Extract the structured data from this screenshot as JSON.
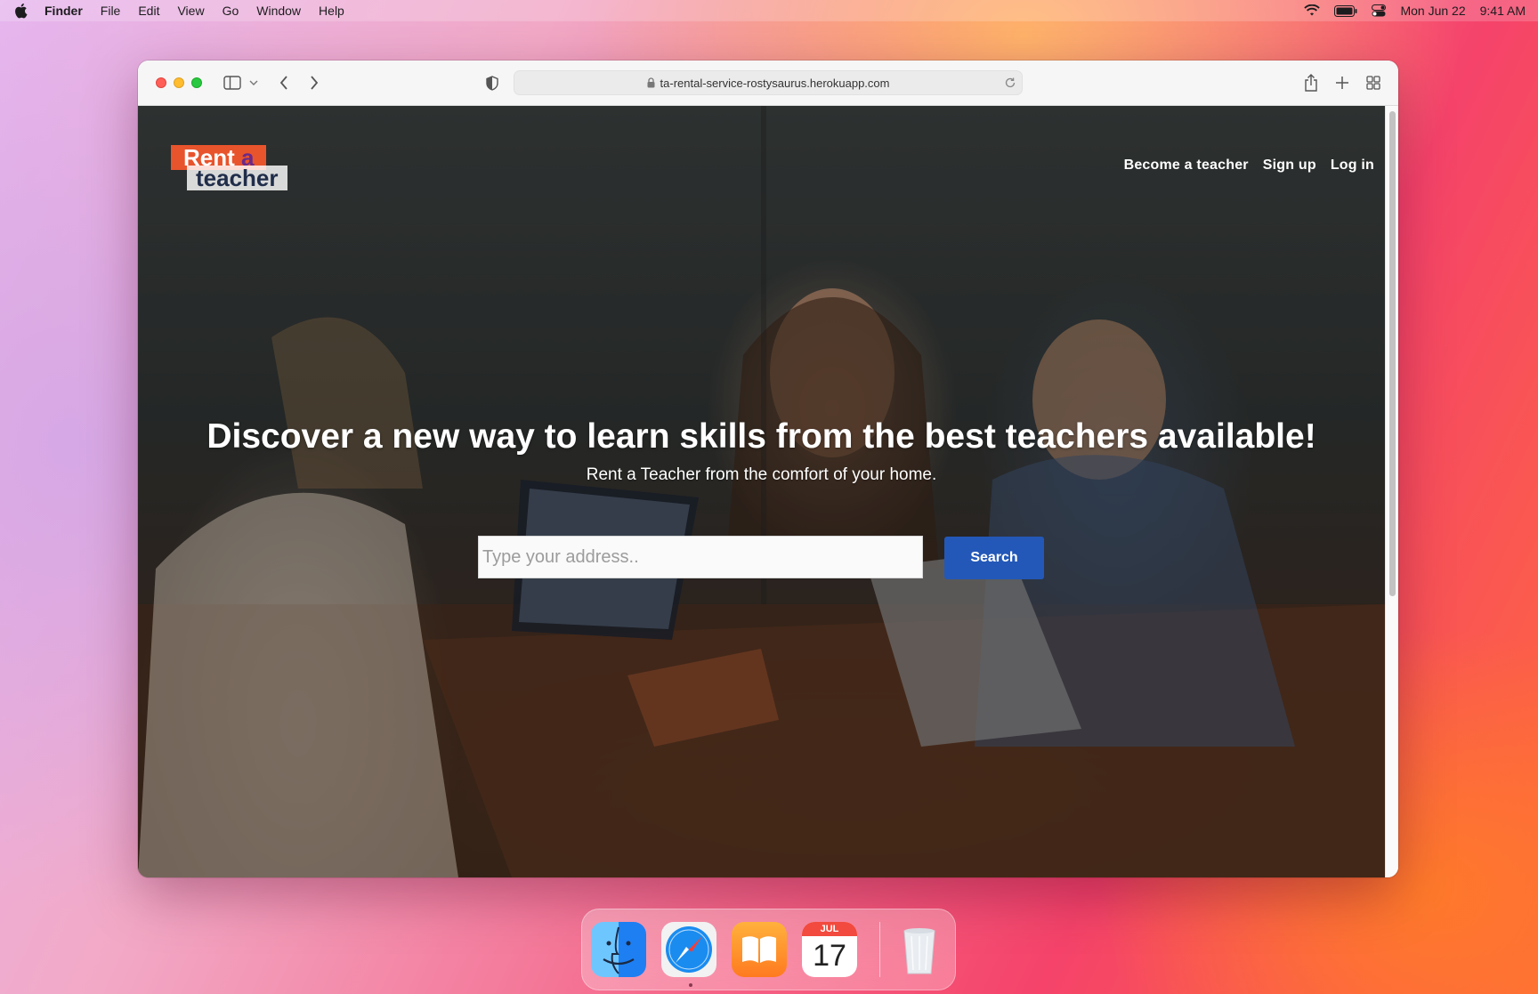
{
  "menubar": {
    "app_name": "Finder",
    "items": [
      "File",
      "Edit",
      "View",
      "Go",
      "Window",
      "Help"
    ],
    "date": "Mon Jun 22",
    "time": "9:41 AM"
  },
  "browser": {
    "url": "ta-rental-service-rostysaurus.herokuapp.com"
  },
  "site": {
    "logo_top": "Rent",
    "logo_top_accent": "a",
    "logo_bottom": "teacher",
    "nav": {
      "become_teacher": "Become a teacher",
      "sign_up": "Sign up",
      "log_in": "Log in"
    },
    "hero_title": "Discover a new way to learn skills from the best teachers available!",
    "hero_subtitle": "Rent a Teacher from the comfort of your home.",
    "search": {
      "placeholder": "Type your address..",
      "value": "",
      "button_label": "Search"
    }
  },
  "dock": {
    "calendar_month": "JUL",
    "calendar_day": "17",
    "apps": [
      "finder-icon",
      "safari-icon",
      "books-icon",
      "calendar-icon",
      "trash-icon"
    ]
  },
  "colors": {
    "search_button": "#2358b8",
    "logo_orange": "#e8542c",
    "logo_accent": "#6a2a8a"
  }
}
